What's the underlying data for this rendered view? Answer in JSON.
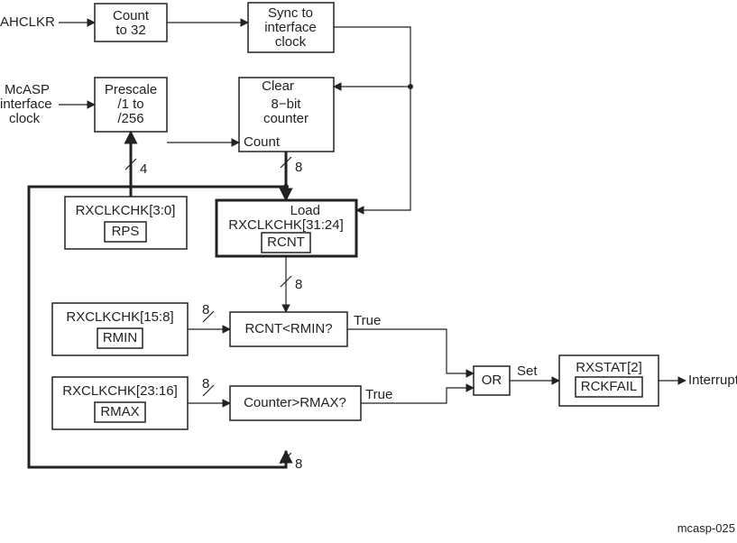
{
  "inputs": {
    "ahclkr": "AHCLKR",
    "mcasp_l1": "McASP",
    "mcasp_l2": "interface",
    "mcasp_l3": "clock"
  },
  "blocks": {
    "count32_l1": "Count",
    "count32_l2": "to 32",
    "sync_l1": "Sync to",
    "sync_l2": "interface",
    "sync_l3": "clock",
    "prescale_l1": "Prescale",
    "prescale_l2": "/1 to",
    "prescale_l3": "/256",
    "cnt_clear": "Clear",
    "cnt_l1": "8−bit",
    "cnt_l2": "counter",
    "cnt_count": "Count",
    "rps_reg": "RXCLKCHK[3:0]",
    "rps_name": "RPS",
    "load_label": "Load",
    "rcnt_reg": "RXCLKCHK[31:24]",
    "rcnt_name": "RCNT",
    "rmin_reg": "RXCLKCHK[15:8]",
    "rmin_name": "RMIN",
    "rmax_reg": "RXCLKCHK[23:16]",
    "rmax_name": "RMAX",
    "cmp_rmin": "RCNT<RMIN?",
    "cmp_rmax": "Counter>RMAX?",
    "or": "OR",
    "rxstat_reg": "RXSTAT[2]",
    "rxstat_name": "RCKFAIL"
  },
  "signals": {
    "true": "True",
    "set": "Set",
    "interrupt": "Interrupt"
  },
  "bus": {
    "four": "4",
    "eight": "8"
  },
  "footer": "mcasp-025"
}
